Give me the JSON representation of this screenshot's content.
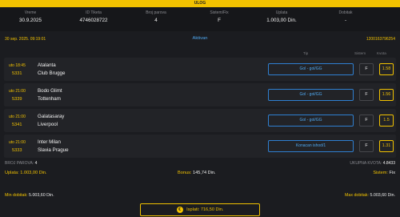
{
  "header": {
    "title": "ULOG"
  },
  "summary": [
    {
      "label": "Vreme",
      "value": "30.9.2025"
    },
    {
      "label": "ID Tiketa",
      "value": "4746028722"
    },
    {
      "label": "Broj parova",
      "value": "4"
    },
    {
      "label": "Sistem/Fix",
      "value": "F"
    },
    {
      "label": "Uplata",
      "value": "1.003,00 Din."
    },
    {
      "label": "Dobitak",
      "value": "-"
    }
  ],
  "status": {
    "datetime": "30 sep. 2025. 09:19:01",
    "state": "Aktivan",
    "code": "1200163796254"
  },
  "columns": {
    "tip": "Tip",
    "sistem": "Sistem",
    "kvota": "Kvota"
  },
  "matches": [
    {
      "time": "uto 18:45",
      "id": "5331",
      "home": "Atalanta",
      "away": "Club Brugge",
      "tip": "Gol - gol/GG",
      "system": "F",
      "odd": "1.58"
    },
    {
      "time": "uto 21:00",
      "id": "5339",
      "home": "Bodo Glimt",
      "away": "Tottenham",
      "tip": "Gol - gol/GG",
      "system": "F",
      "odd": "1.56"
    },
    {
      "time": "uto 21:00",
      "id": "5341",
      "home": "Galatasaray",
      "away": "Liverpool",
      "tip": "Gol - gol/GG",
      "system": "F",
      "odd": "1.5"
    },
    {
      "time": "uto 21:00",
      "id": "5333",
      "home": "Inter Milan",
      "away": "Slavia Prague",
      "tip": "Konacan ishod/1",
      "system": "F",
      "odd": "1.31"
    }
  ],
  "totals": {
    "pairs_label": "BROJ PAROVA:",
    "pairs_value": "4",
    "quota_label": "UKUPNA KVOTA:",
    "quota_value": "4.8433",
    "stake_label": "Uplata:",
    "stake_value": "1.003,00 Din.",
    "bonus_label": "Bonus:",
    "bonus_value": "145,74 Din.",
    "system_label": "Sistem:",
    "system_value": "Fix"
  },
  "minmax": {
    "min_label": "Min dobitak:",
    "min_value": "5.003,60 Din.",
    "max_label": "Max dobitak:",
    "max_value": "5.003,60 Din."
  },
  "payout": {
    "label": "Isplati: 716,50 Din.",
    "icon": "coin-icon"
  },
  "colors": {
    "accent": "#f2c200",
    "link": "#4fa8f0",
    "background": "#1b1c20"
  }
}
